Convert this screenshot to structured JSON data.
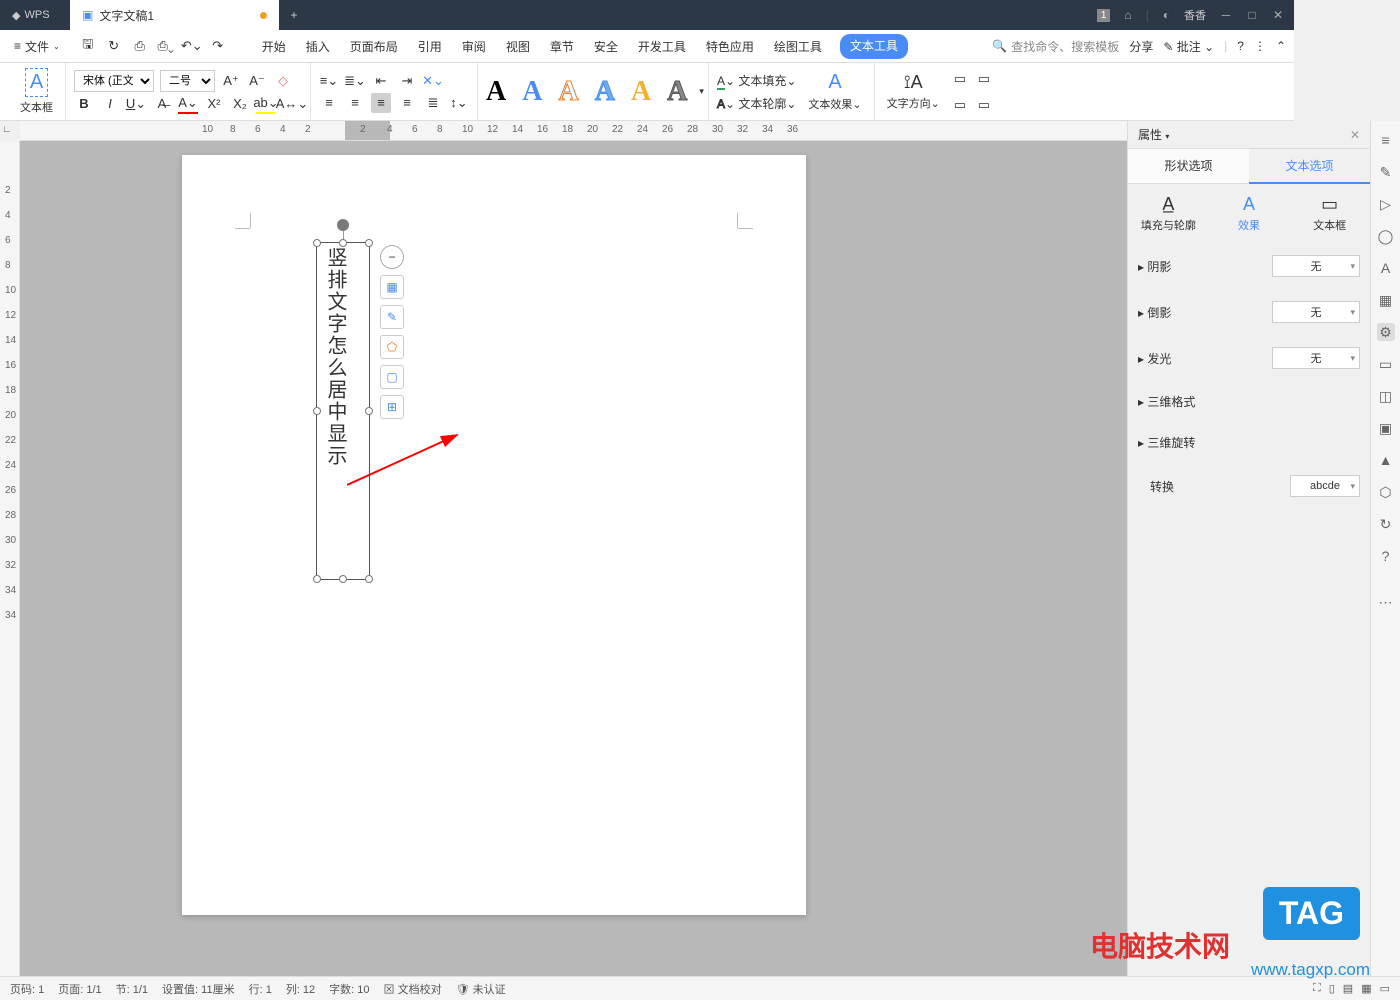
{
  "app": {
    "name": "WPS"
  },
  "doc": {
    "tab_title": "文字文稿1"
  },
  "titlebar_right": {
    "badge": "1",
    "user": "香香"
  },
  "menu": {
    "file": "文件",
    "tabs": [
      "开始",
      "插入",
      "页面布局",
      "引用",
      "审阅",
      "视图",
      "章节",
      "安全",
      "开发工具",
      "特色应用",
      "绘图工具",
      "文本工具"
    ],
    "active_tab": "文本工具",
    "search_placeholder": "查找命令、搜索模板",
    "share": "分享",
    "comment": "批注"
  },
  "ribbon": {
    "textbox_label": "文本框",
    "font_name": "宋体 (正文)",
    "font_size": "二号",
    "text_fill": "文本填充",
    "text_outline": "文本轮廓",
    "text_effects": "文本效果",
    "text_direction": "文字方向"
  },
  "ruler_h": [
    "10",
    "8",
    "6",
    "4",
    "2",
    "2",
    "4",
    "6",
    "8",
    "10",
    "12",
    "14",
    "16",
    "18",
    "20",
    "22",
    "24",
    "26",
    "28",
    "30",
    "32",
    "34",
    "36"
  ],
  "ruler_v": [
    "2",
    "4",
    "6",
    "8",
    "10",
    "12",
    "14",
    "16",
    "18",
    "20",
    "22",
    "24",
    "26",
    "28",
    "30",
    "32",
    "34"
  ],
  "textbox_content": "竖排文字怎么居中显示",
  "panel": {
    "title": "属性",
    "tabs": {
      "shape": "形状选项",
      "text": "文本选项"
    },
    "subtabs": {
      "fill": "填充与轮廓",
      "effects": "效果",
      "textbox": "文本框"
    },
    "shadow": {
      "label": "阴影",
      "value": "无"
    },
    "reflection": {
      "label": "倒影",
      "value": "无"
    },
    "glow": {
      "label": "发光",
      "value": "无"
    },
    "threed_format": "三维格式",
    "threed_rotate": "三维旋转",
    "transform": {
      "label": "转换",
      "value": "abcde"
    }
  },
  "status": {
    "page_no": "页码: 1",
    "page": "页面: 1/1",
    "section": "节: 1/1",
    "offset": "设置值: 11厘米",
    "row": "行: 1",
    "col": "列: 12",
    "words": "字数: 10",
    "proof": "文档校对",
    "auth": "未认证"
  },
  "watermark": {
    "site_cn": "电脑技术网",
    "url": "www.tagxp.com",
    "tag": "TAG"
  }
}
